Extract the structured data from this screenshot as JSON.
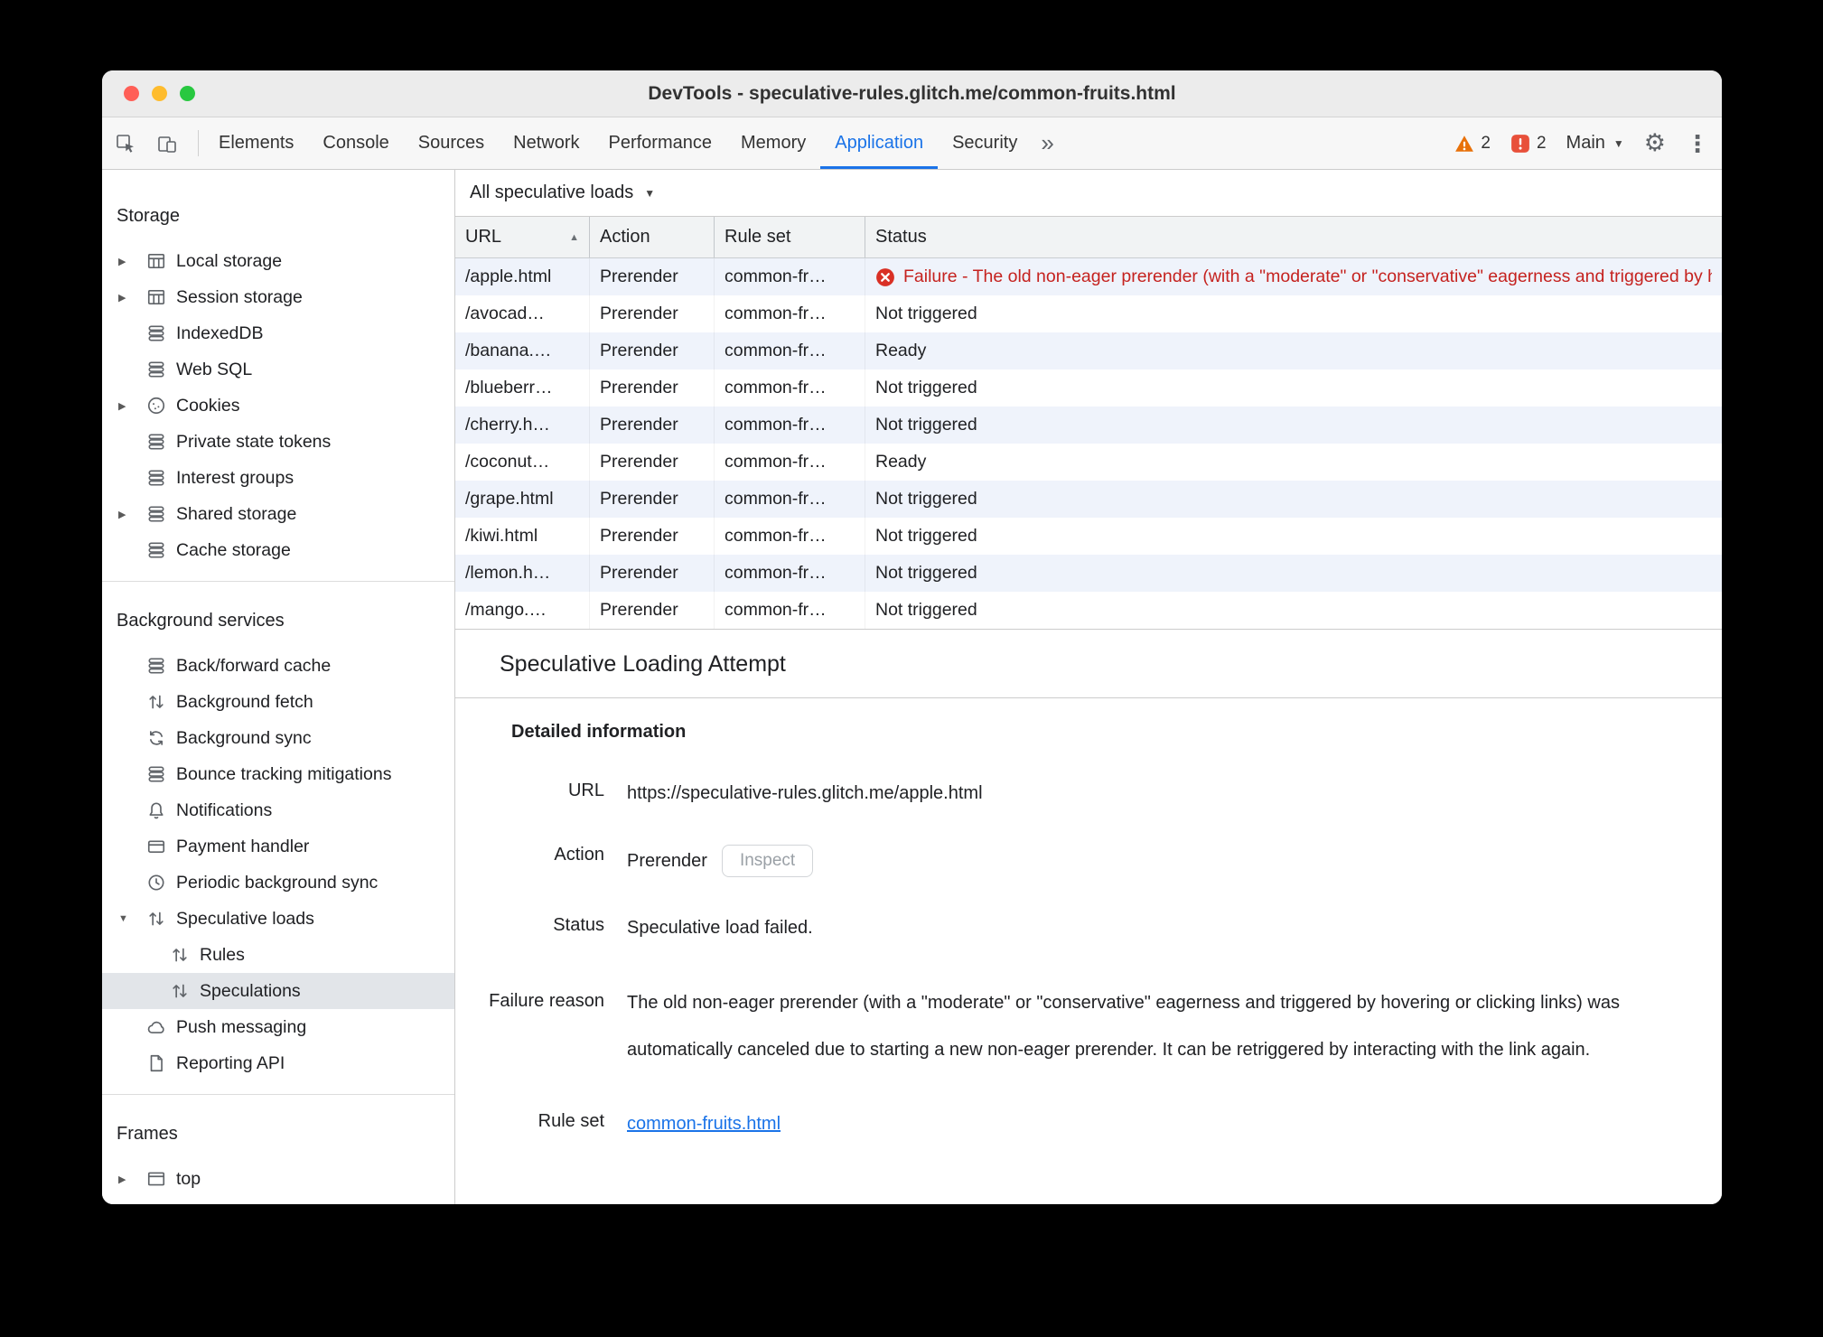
{
  "window": {
    "title": "DevTools - speculative-rules.glitch.me/common-fruits.html"
  },
  "toolbar": {
    "tabs": [
      {
        "label": "Elements",
        "active": false
      },
      {
        "label": "Console",
        "active": false
      },
      {
        "label": "Sources",
        "active": false
      },
      {
        "label": "Network",
        "active": false
      },
      {
        "label": "Performance",
        "active": false
      },
      {
        "label": "Memory",
        "active": false
      },
      {
        "label": "Application",
        "active": true
      },
      {
        "label": "Security",
        "active": false
      }
    ],
    "more_tabs": "»",
    "warning_count": "2",
    "issue_count": "2",
    "target_label": "Main",
    "colors": {
      "accent": "#1a73e8",
      "warning": "#e8710a",
      "issue": "#e8503a"
    }
  },
  "sidebar": {
    "sections": [
      {
        "title": "Storage",
        "items": [
          {
            "label": "Local storage",
            "icon": "table-icon",
            "expander": "collapsed"
          },
          {
            "label": "Session storage",
            "icon": "table-icon",
            "expander": "collapsed"
          },
          {
            "label": "IndexedDB",
            "icon": "database-icon"
          },
          {
            "label": "Web SQL",
            "icon": "database-icon"
          },
          {
            "label": "Cookies",
            "icon": "cookie-icon",
            "expander": "collapsed"
          },
          {
            "label": "Private state tokens",
            "icon": "database-icon"
          },
          {
            "label": "Interest groups",
            "icon": "database-icon"
          },
          {
            "label": "Shared storage",
            "icon": "database-icon",
            "expander": "collapsed"
          },
          {
            "label": "Cache storage",
            "icon": "database-icon"
          }
        ]
      },
      {
        "title": "Background services",
        "items": [
          {
            "label": "Back/forward cache",
            "icon": "database-icon"
          },
          {
            "label": "Background fetch",
            "icon": "up-down-arrows-icon"
          },
          {
            "label": "Background sync",
            "icon": "sync-icon"
          },
          {
            "label": "Bounce tracking mitigations",
            "icon": "database-icon"
          },
          {
            "label": "Notifications",
            "icon": "bell-icon"
          },
          {
            "label": "Payment handler",
            "icon": "payment-card-icon"
          },
          {
            "label": "Periodic background sync",
            "icon": "clock-icon"
          },
          {
            "label": "Speculative loads",
            "icon": "up-down-arrows-icon",
            "expander": "expanded"
          },
          {
            "label": "Rules",
            "icon": "up-down-arrows-icon",
            "nested": true
          },
          {
            "label": "Speculations",
            "icon": "up-down-arrows-icon",
            "nested": true,
            "selected": true
          },
          {
            "label": "Push messaging",
            "icon": "cloud-icon"
          },
          {
            "label": "Reporting API",
            "icon": "document-icon"
          }
        ]
      },
      {
        "title": "Frames",
        "items": [
          {
            "label": "top",
            "icon": "frame-icon",
            "expander": "collapsed"
          }
        ]
      }
    ]
  },
  "main": {
    "filter_label": "All speculative loads",
    "table": {
      "columns": [
        {
          "label": "URL",
          "sorted": "asc"
        },
        {
          "label": "Action"
        },
        {
          "label": "Rule set"
        },
        {
          "label": "Status"
        }
      ],
      "rows": [
        {
          "url": "/apple.html",
          "action": "Prerender",
          "rule_set": "common-fr…",
          "status": "Failure - The old non-eager prerender (with a \"moderate\" or \"conservative\" eagerness and triggered by hovering or clicking links) was automatically canceled",
          "status_type": "failure"
        },
        {
          "url": "/avocad…",
          "action": "Prerender",
          "rule_set": "common-fr…",
          "status": "Not triggered",
          "status_type": "not-triggered"
        },
        {
          "url": "/banana.…",
          "action": "Prerender",
          "rule_set": "common-fr…",
          "status": "Ready",
          "status_type": "ready"
        },
        {
          "url": "/blueberr…",
          "action": "Prerender",
          "rule_set": "common-fr…",
          "status": "Not triggered",
          "status_type": "not-triggered"
        },
        {
          "url": "/cherry.h…",
          "action": "Prerender",
          "rule_set": "common-fr…",
          "status": "Not triggered",
          "status_type": "not-triggered"
        },
        {
          "url": "/coconut…",
          "action": "Prerender",
          "rule_set": "common-fr…",
          "status": "Ready",
          "status_type": "ready"
        },
        {
          "url": "/grape.html",
          "action": "Prerender",
          "rule_set": "common-fr…",
          "status": "Not triggered",
          "status_type": "not-triggered"
        },
        {
          "url": "/kiwi.html",
          "action": "Prerender",
          "rule_set": "common-fr…",
          "status": "Not triggered",
          "status_type": "not-triggered"
        },
        {
          "url": "/lemon.h…",
          "action": "Prerender",
          "rule_set": "common-fr…",
          "status": "Not triggered",
          "status_type": "not-triggered"
        },
        {
          "url": "/mango.…",
          "action": "Prerender",
          "rule_set": "common-fr…",
          "status": "Not triggered",
          "status_type": "not-triggered"
        }
      ]
    },
    "details": {
      "title": "Speculative Loading Attempt",
      "section_title": "Detailed information",
      "url_label": "URL",
      "url_value": "https://speculative-rules.glitch.me/apple.html",
      "action_label": "Action",
      "action_value": "Prerender",
      "inspect_button": "Inspect",
      "status_label": "Status",
      "status_value": "Speculative load failed.",
      "failure_label": "Failure reason",
      "failure_value": "The old non-eager prerender (with a \"moderate\" or \"conservative\" eagerness and triggered by hovering or clicking links) was automatically canceled due to starting a new non-eager prerender. It can be retriggered by interacting with the link again.",
      "ruleset_label": "Rule set",
      "ruleset_value": "common-fruits.html"
    }
  }
}
